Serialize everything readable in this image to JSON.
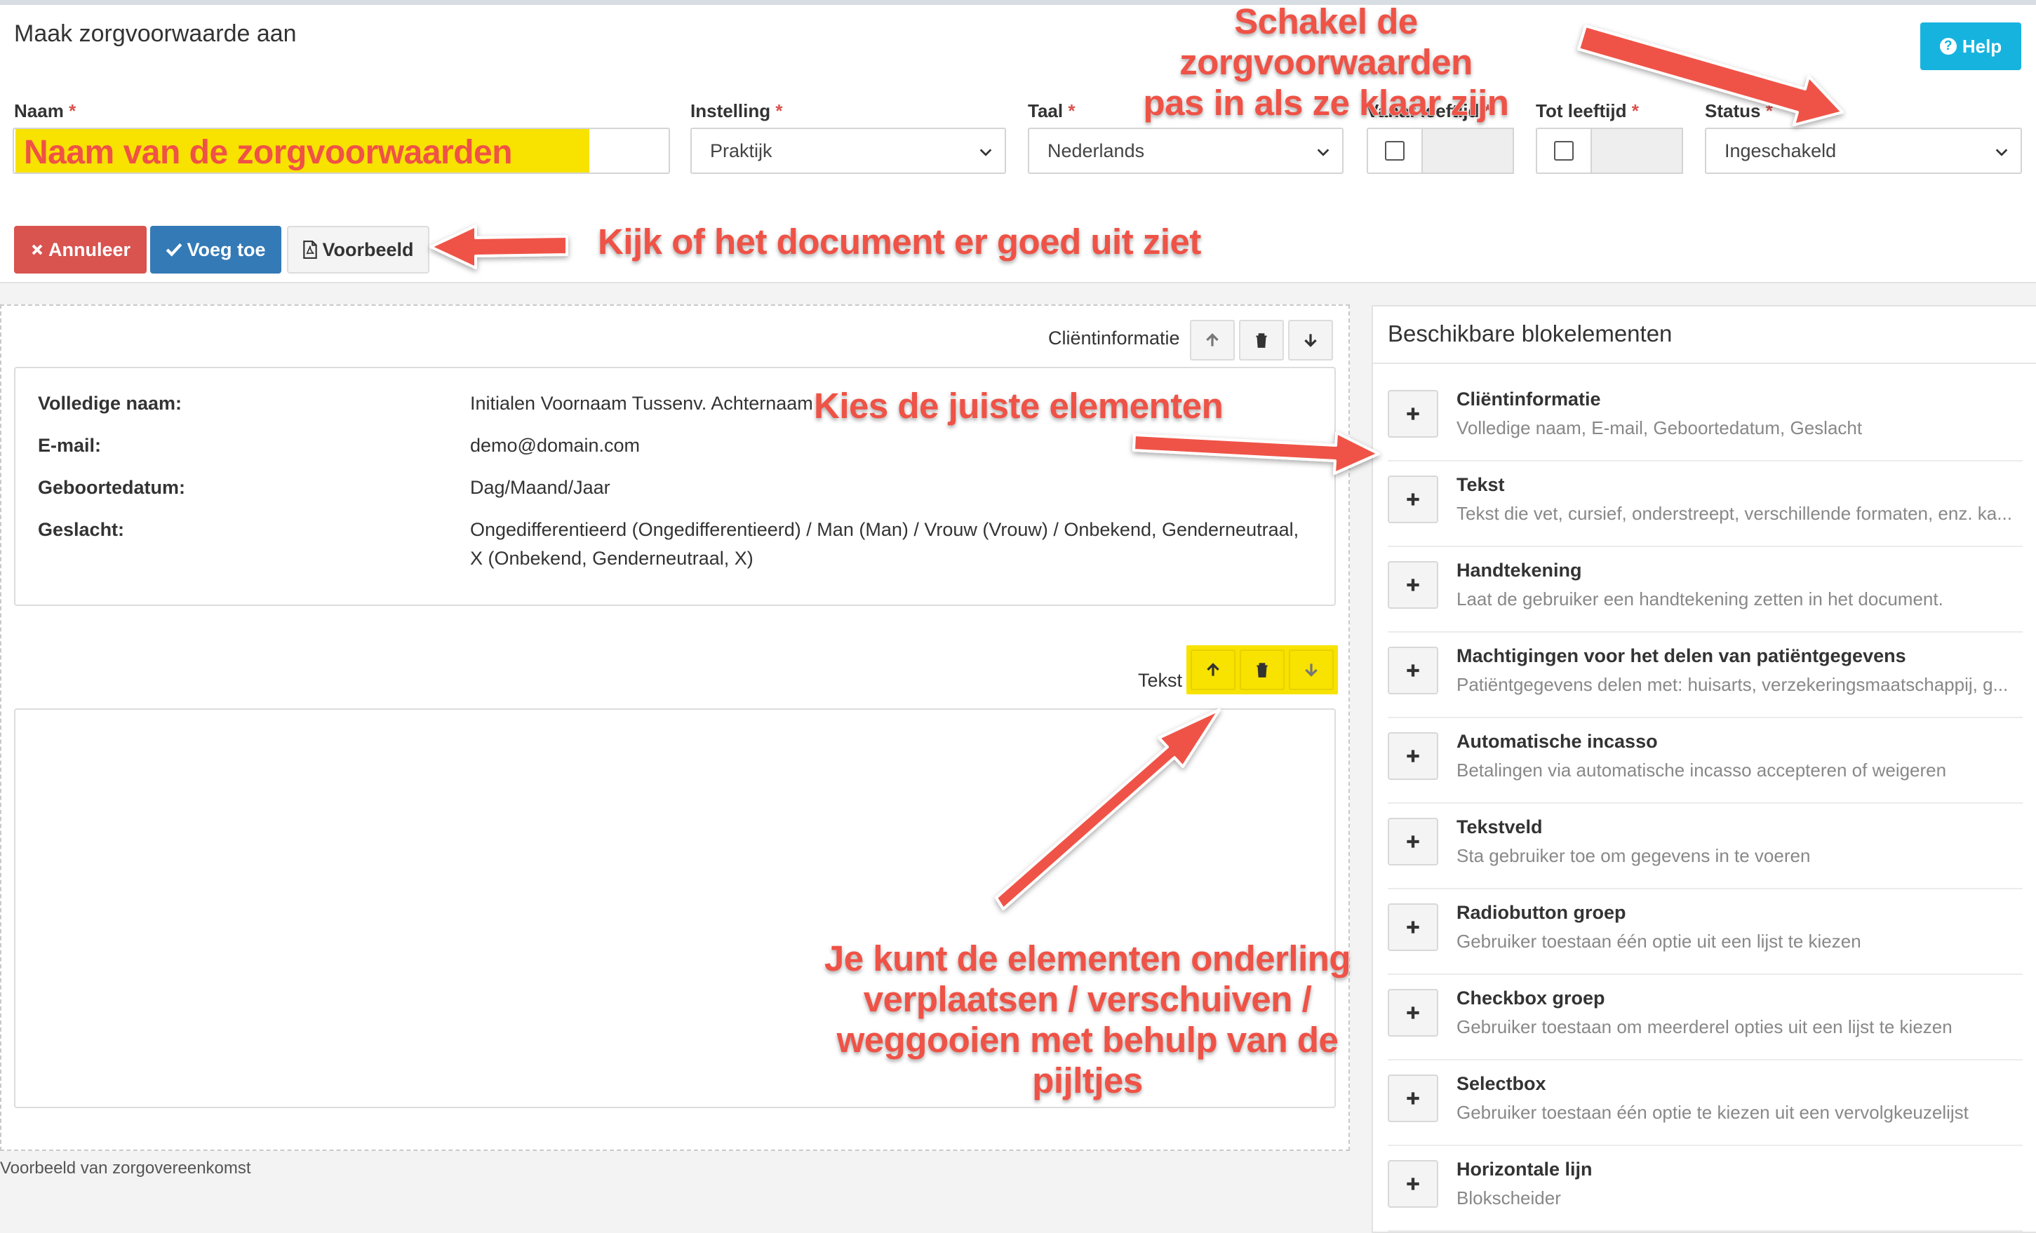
{
  "header": {
    "title": "Maak zorgvoorwaarde aan",
    "help_label": "Help"
  },
  "form": {
    "naam": {
      "label": "Naam",
      "value": "Naam van de zorgvoorwaarden"
    },
    "instelling": {
      "label": "Instelling",
      "value": "Praktijk"
    },
    "taal": {
      "label": "Taal",
      "value": "Nederlands"
    },
    "vanaf": {
      "label": "Vanaf leeftijd"
    },
    "tot": {
      "label": "Tot leeftijd"
    },
    "status": {
      "label": "Status",
      "value": "Ingeschakeld"
    },
    "required_mark": "*"
  },
  "toolbar": {
    "cancel_label": "Annuleer",
    "add_label": "Voeg toe",
    "preview_label": "Voorbeeld"
  },
  "content": {
    "client_block_label": "Cliëntinformatie",
    "text_block_label": "Tekst",
    "fields": [
      {
        "label": "Volledige naam:",
        "value": "Initialen Voornaam Tussenv. Achternaam"
      },
      {
        "label": "E-mail:",
        "value": "demo@domain.com"
      },
      {
        "label": "Geboortedatum:",
        "value": "Dag/Maand/Jaar"
      },
      {
        "label": "Geslacht:",
        "value": "Ongedifferentieerd (Ongedifferentieerd) / Man (Man) / Vrouw (Vrouw) / Onbekend, Genderneutraal, X (Onbekend, Genderneutraal, X)"
      }
    ],
    "footer_note": "Voorbeeld van zorgovereenkomst"
  },
  "sidebar": {
    "title": "Beschikbare blokelementen",
    "items": [
      {
        "title": "Cliëntinformatie",
        "desc": "Volledige naam, E-mail, Geboortedatum, Geslacht"
      },
      {
        "title": "Tekst",
        "desc": "Tekst die vet, cursief, onderstreept, verschillende formaten, enz. ka..."
      },
      {
        "title": "Handtekening",
        "desc": "Laat de gebruiker een handtekening zetten in het document."
      },
      {
        "title": "Machtigingen voor het delen van patiëntgegevens",
        "desc": "Patiëntgegevens delen met: huisarts, verzekeringsmaatschappij, g..."
      },
      {
        "title": "Automatische incasso",
        "desc": "Betalingen via automatische incasso accepteren of weigeren"
      },
      {
        "title": "Tekstveld",
        "desc": "Sta gebruiker toe om gegevens in te voeren"
      },
      {
        "title": "Radiobutton groep",
        "desc": "Gebruiker toestaan één optie uit een lijst te kiezen"
      },
      {
        "title": "Checkbox groep",
        "desc": "Gebruiker toestaan om meerderel opties uit een lijst te kiezen"
      },
      {
        "title": "Selectbox",
        "desc": "Gebruiker toestaan één optie te kiezen uit een vervolgkeuzelijst"
      },
      {
        "title": "Horizontale lijn",
        "desc": "Blokscheider"
      }
    ]
  },
  "annotations": {
    "status_line1": "Schakel de zorgvoorwaarden",
    "status_line2": "pas in als ze klaar zijn",
    "preview": "Kijk of het document er goed uit ziet",
    "elements": "Kies de juiste elementen",
    "move_line1": "Je kunt de elementen onderling",
    "move_line2": "verplaatsen /  verschuiven /",
    "move_line3": "weggooien met behulp van de",
    "move_line4": "pijltjes",
    "color": "#ef5246",
    "highlight_color": "#f7e200"
  }
}
